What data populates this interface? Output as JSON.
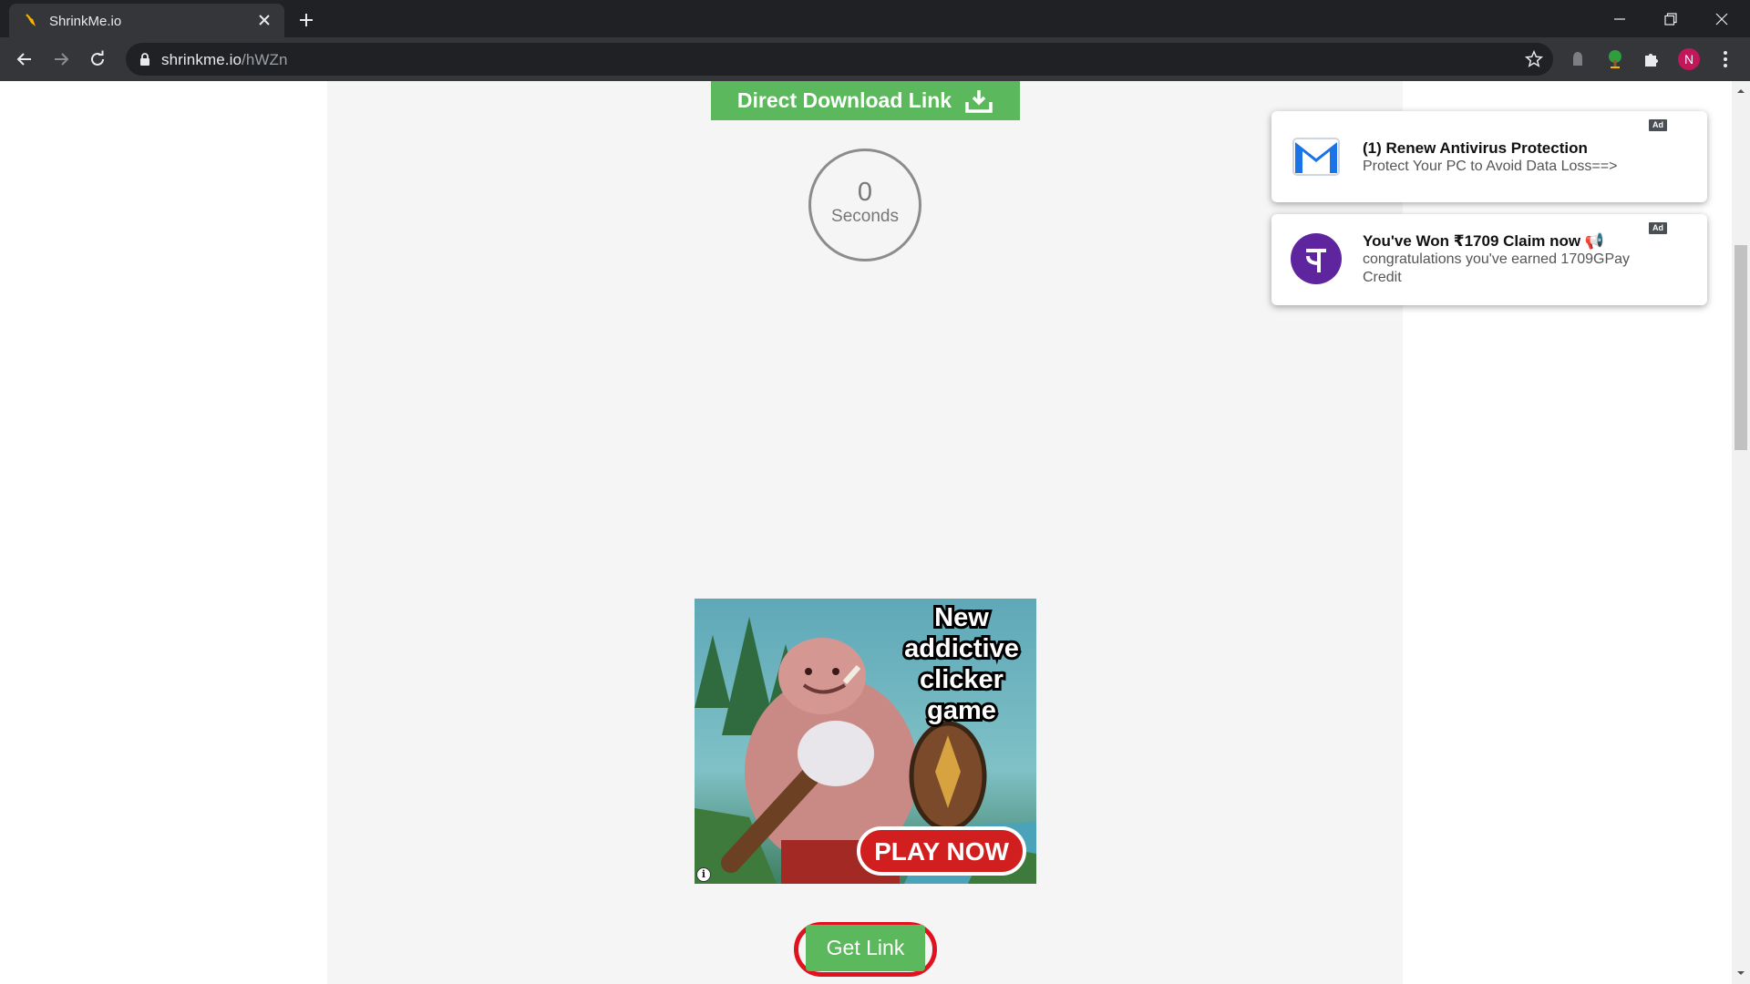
{
  "browser": {
    "tab_title": "ShrinkMe.io",
    "url_host": "shrinkme.io",
    "url_path": "/hWZn",
    "profile_initial": "N"
  },
  "page": {
    "direct_download_label": "Direct Download Link",
    "timer_value": "0",
    "timer_label": "Seconds",
    "get_link_label": "Get Link",
    "game_ad": {
      "headline_lines": [
        "New",
        "addictive",
        "clicker",
        "game"
      ],
      "cta": "PLAY NOW",
      "info": "i"
    }
  },
  "notifications": [
    {
      "title": "(1) Renew Antivirus Protection",
      "body": "Protect Your PC to Avoid Data Loss==>",
      "badge": "Ad",
      "icon": "mail-icon"
    },
    {
      "title": "You've Won ₹1709 Claim now 📢",
      "body": "congratulations you've earned 1709GPay Credit",
      "badge": "Ad",
      "icon": "phonepe-icon"
    }
  ],
  "colors": {
    "accent_green": "#5cb85c",
    "highlight_red": "#e0121e",
    "chrome_dark": "#202124",
    "chrome_toolbar": "#35363a"
  }
}
